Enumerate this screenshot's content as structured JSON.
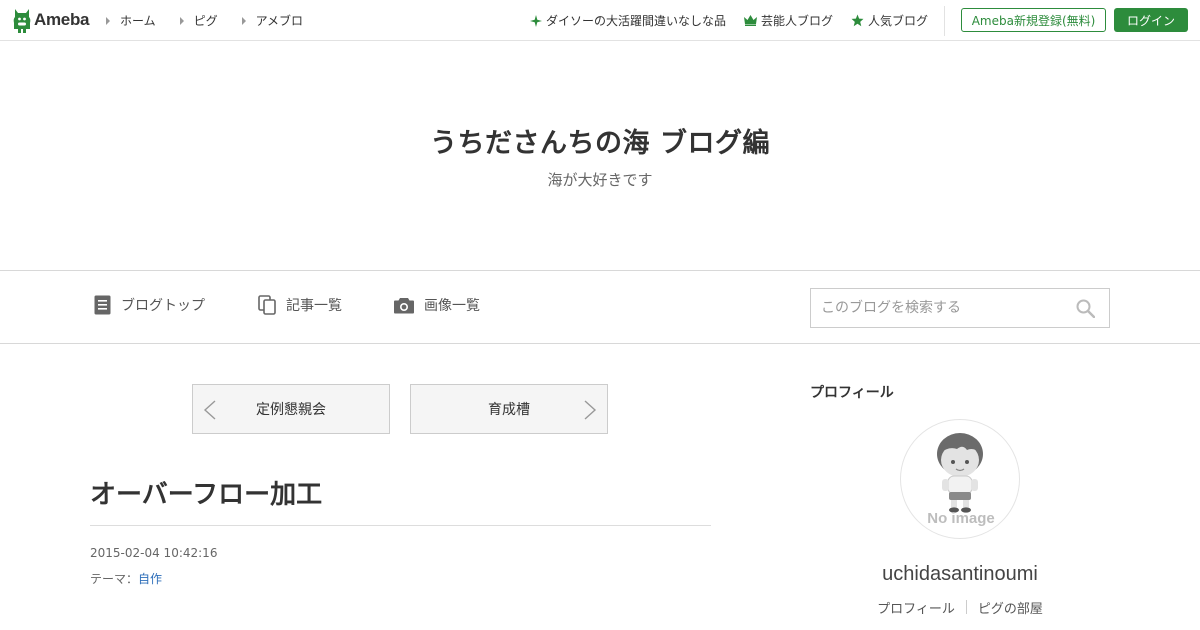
{
  "topbar": {
    "logo_text": "Ameba",
    "nav": [
      {
        "label": "ホーム"
      },
      {
        "label": "ピグ"
      },
      {
        "label": "アメブロ"
      }
    ],
    "links": [
      {
        "icon": "sparkle-icon",
        "label": "ダイソーの大活躍間違いなしな品"
      },
      {
        "icon": "crown-icon",
        "label": "芸能人ブログ"
      },
      {
        "icon": "star-icon",
        "label": "人気ブログ"
      }
    ],
    "register_label": "Ameba新規登録(無料)",
    "login_label": "ログイン",
    "accent_color": "#2d8c3c"
  },
  "blog": {
    "title": "うちださんちの海 ブログ編",
    "description": "海が大好きです"
  },
  "blognav": {
    "items": [
      {
        "icon": "document-icon",
        "label": "ブログトップ"
      },
      {
        "icon": "copy-icon",
        "label": "記事一覧"
      },
      {
        "icon": "camera-icon",
        "label": "画像一覧"
      }
    ],
    "search_placeholder": "このブログを検索する"
  },
  "pager": {
    "prev_label": "定例懇親会",
    "next_label": "育成槽"
  },
  "article": {
    "title": "オーバーフロー加工",
    "date": "2015-02-04 10:42:16",
    "theme_label": "テーマ：",
    "theme_value": "自作",
    "link_color": "#2f6fba"
  },
  "sidebar": {
    "heading": "プロフィール",
    "avatar_placeholder": "No image",
    "username": "uchidasantinoumi",
    "links": [
      {
        "label": "プロフィール"
      },
      {
        "label": "ピグの部屋"
      }
    ]
  }
}
